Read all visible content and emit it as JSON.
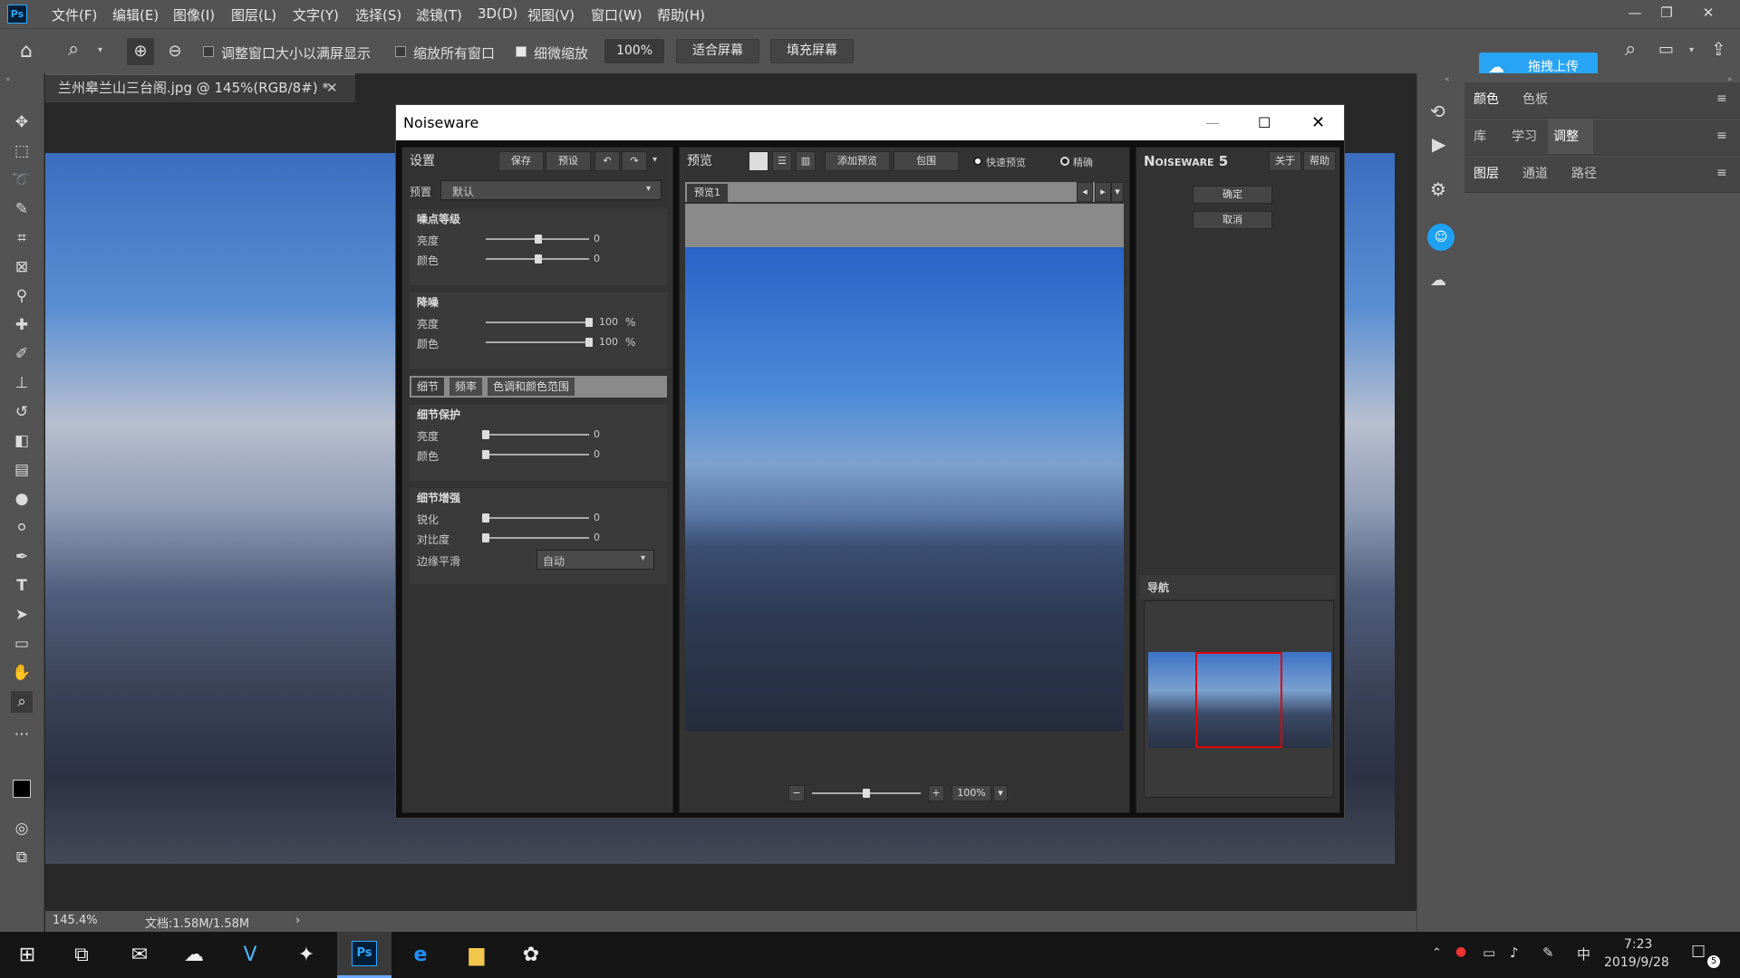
{
  "menubar": {
    "logo": "Ps",
    "items": [
      "文件(F)",
      "编辑(E)",
      "图像(I)",
      "图层(L)",
      "文字(Y)",
      "选择(S)",
      "滤镜(T)",
      "3D(D)",
      "视图(V)",
      "窗口(W)",
      "帮助(H)"
    ]
  },
  "options": {
    "resize_windows": "调整窗口大小以满屏显示",
    "zoom_all": "缩放所有窗口",
    "scrubby_zoom": "细微缩放",
    "zoom_value": "100%",
    "fit_screen": "适合屏幕",
    "fill_screen": "填充屏幕",
    "upload": "拖拽上传"
  },
  "document": {
    "tab_title": "兰州皋兰山三台阁.jpg @ 145%(RGB/8#) *",
    "zoom": "145.4%",
    "doc_info": "文档:1.58M/1.58M"
  },
  "right_panel": {
    "row1": [
      "颜色",
      "色板"
    ],
    "row2": [
      "库",
      "学习",
      "调整"
    ],
    "row3": [
      "图层",
      "通道",
      "路径"
    ]
  },
  "noiseware": {
    "title": "Noiseware",
    "settings": {
      "header": "设置",
      "save": "保存",
      "preset_btn": "预设",
      "preset_label": "预置",
      "preset_value": "默认",
      "noise_level": {
        "title": "噪点等级",
        "rows": [
          {
            "label": "亮度",
            "value": "0"
          },
          {
            "label": "颜色",
            "value": "0"
          }
        ]
      },
      "denoise": {
        "title": "降噪",
        "rows": [
          {
            "label": "亮度",
            "value": "100",
            "unit": "%"
          },
          {
            "label": "颜色",
            "value": "100",
            "unit": "%"
          }
        ]
      },
      "tabs": [
        "细节",
        "频率",
        "色调和颜色范围"
      ],
      "detail_protect": {
        "title": "细节保护",
        "rows": [
          {
            "label": "亮度",
            "value": "0"
          },
          {
            "label": "颜色",
            "value": "0"
          }
        ]
      },
      "detail_enhance": {
        "title": "细节增强",
        "rows": [
          {
            "label": "锐化",
            "value": "0"
          },
          {
            "label": "对比度",
            "value": "0"
          }
        ],
        "edge_label": "边缘平滑",
        "edge_value": "自动"
      }
    },
    "preview": {
      "header": "预览",
      "add_preview": "添加预览",
      "clip": "包围",
      "fast_preview": "快速预览",
      "accurate": "精确",
      "tab": "预览1",
      "zoom": "100%",
      "minus": "−",
      "plus": "+"
    },
    "brand": {
      "title": "Noiseware 5",
      "about": "关于",
      "help": "帮助",
      "ok": "确定",
      "cancel": "取消",
      "navigator": "导航"
    }
  },
  "taskbar": {
    "time": "7:23",
    "date": "2019/9/28",
    "ime": "中",
    "notif_count": "5"
  }
}
